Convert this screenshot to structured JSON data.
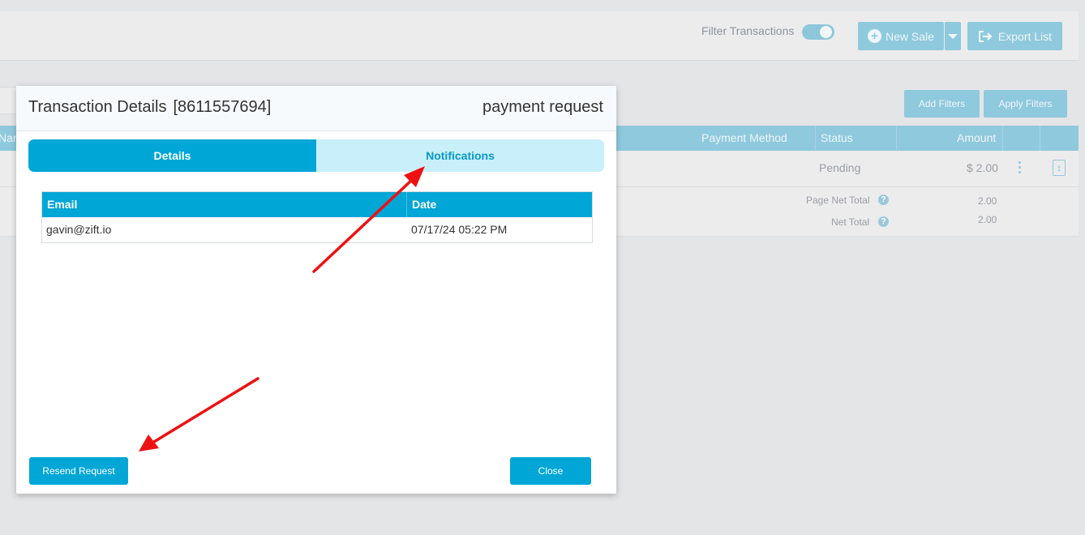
{
  "background": {
    "filter_transactions_label": "Filter Transactions",
    "new_sale_label": "New Sale",
    "export_list_label": "Export List",
    "add_filters_label": "Add Filters",
    "apply_filters_label": "Apply Filters",
    "table_headers": {
      "name_partial": "Nar",
      "payment_method": "Payment Method",
      "status": "Status",
      "amount": "Amount"
    },
    "row": {
      "status": "Pending",
      "amount": "$ 2.00"
    },
    "totals": {
      "page_net_total_label": "Page Net Total",
      "page_net_total_value": "2.00",
      "net_total_label": "Net Total",
      "net_total_value": "2.00"
    }
  },
  "modal": {
    "title": "Transaction Details",
    "transaction_id": "[8611557694]",
    "type": "payment request",
    "tabs": [
      {
        "label": "Details",
        "active": true
      },
      {
        "label": "Notifications",
        "active": false
      }
    ],
    "notifications_table": {
      "columns": [
        "Email",
        "Date"
      ],
      "rows": [
        {
          "email": "gavin@zift.io",
          "date": "07/17/24 05:22 PM"
        }
      ]
    },
    "resend_button_label": "Resend Request",
    "close_button_label": "Close"
  },
  "colors": {
    "primary": "#00a6d6",
    "tab_inactive": "#c9f0fa",
    "background_accent": "#8fc9dd",
    "annotation_arrow": "#ee1111"
  },
  "icons": [
    "plus-circle-icon",
    "chevron-down-icon",
    "export-icon",
    "help-icon",
    "kebab-menu-icon",
    "pdf-icon"
  ]
}
